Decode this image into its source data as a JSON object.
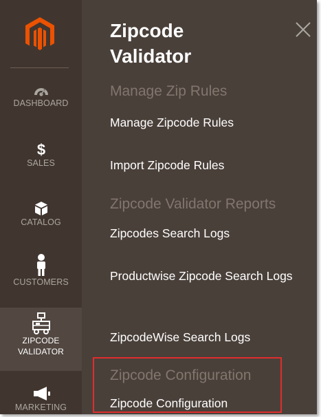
{
  "sidebar": {
    "items": [
      {
        "label": "DASHBOARD",
        "icon": "dashboard-gauge-icon"
      },
      {
        "label": "SALES",
        "icon": "dollar-icon"
      },
      {
        "label": "CATALOG",
        "icon": "box-icon"
      },
      {
        "label": "CUSTOMERS",
        "icon": "person-icon"
      },
      {
        "label_line1": "ZIPCODE",
        "label_line2": "VALIDATOR",
        "icon": "zipcode-validator-icon"
      },
      {
        "label": "MARKETING",
        "icon": "megaphone-icon"
      }
    ]
  },
  "panel": {
    "title_line1": "Zipcode",
    "title_line2": "Validator",
    "sections": [
      {
        "heading": "Manage Zip Rules",
        "links": [
          "Manage Zipcode Rules",
          "Import Zipcode Rules"
        ]
      },
      {
        "heading": "Zipcode Validator Reports",
        "links": [
          "Zipcodes Search Logs",
          "Productwise Zipcode Search Logs",
          "ZipcodeWise Search Logs"
        ]
      },
      {
        "heading": "Zipcode Configuration",
        "links": [
          "Zipcode Configuration"
        ]
      }
    ]
  },
  "colors": {
    "accent": "#eb5202",
    "highlight": "#e02d2d",
    "sidebar_bg": "#41362f",
    "panel_bg": "#4a403a"
  }
}
